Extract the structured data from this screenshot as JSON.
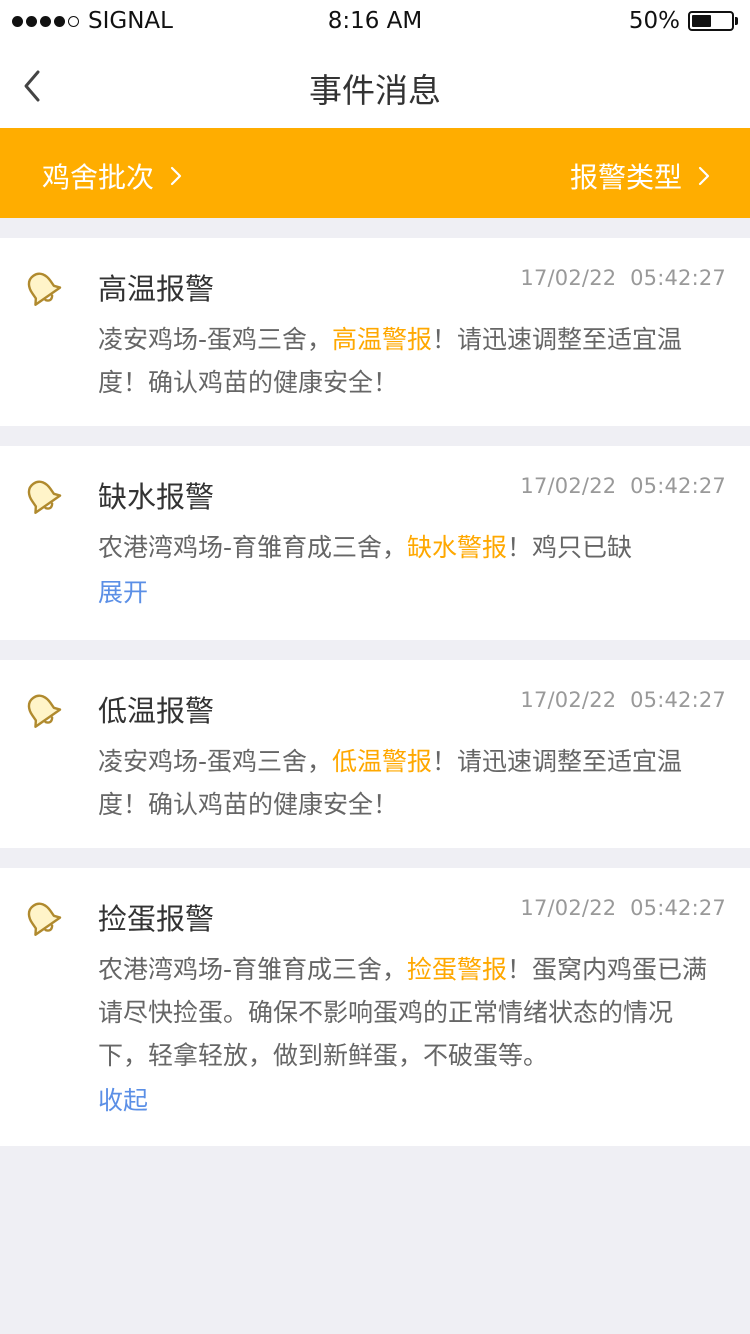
{
  "status_bar": {
    "carrier": "SIGNAL",
    "time": "8:16 AM",
    "battery_percent": "50%",
    "battery_level": 0.5,
    "signal_dots": [
      true,
      true,
      true,
      true,
      false
    ]
  },
  "nav": {
    "title": "事件消息",
    "back_icon": "chevron-left-icon"
  },
  "filters": {
    "left_label": "鸡舍批次",
    "right_label": "报警类型",
    "background": "#ffad00"
  },
  "colors": {
    "accent": "#ffa800",
    "link": "#5b8fe6",
    "bell": "#b08a2e"
  },
  "messages": [
    {
      "title": "高温报警",
      "time": "17/02/22  05:42:27",
      "body_pre": "凌安鸡场-蛋鸡三舍，",
      "body_highlight": "高温警报",
      "body_post": "！请迅速调整至适宜温度！确认鸡苗的健康安全！",
      "toggle": ""
    },
    {
      "title": "缺水报警",
      "time": "17/02/22  05:42:27",
      "body_pre": "农港湾鸡场-育雏育成三舍，",
      "body_highlight": "缺水警报",
      "body_post": "！鸡只已缺",
      "toggle": "展开"
    },
    {
      "title": "低温报警",
      "time": "17/02/22  05:42:27",
      "body_pre": "凌安鸡场-蛋鸡三舍，",
      "body_highlight": "低温警报",
      "body_post": "！请迅速调整至适宜温度！确认鸡苗的健康安全！",
      "toggle": ""
    },
    {
      "title": "捡蛋报警",
      "time": "17/02/22  05:42:27",
      "body_pre": "农港湾鸡场-育雏育成三舍，",
      "body_highlight": "捡蛋警报",
      "body_post": "！蛋窝内鸡蛋已满请尽快捡蛋。确保不影响蛋鸡的正常情绪状态的情况下，轻拿轻放，做到新鲜蛋，不破蛋等。",
      "toggle": "收起"
    }
  ]
}
